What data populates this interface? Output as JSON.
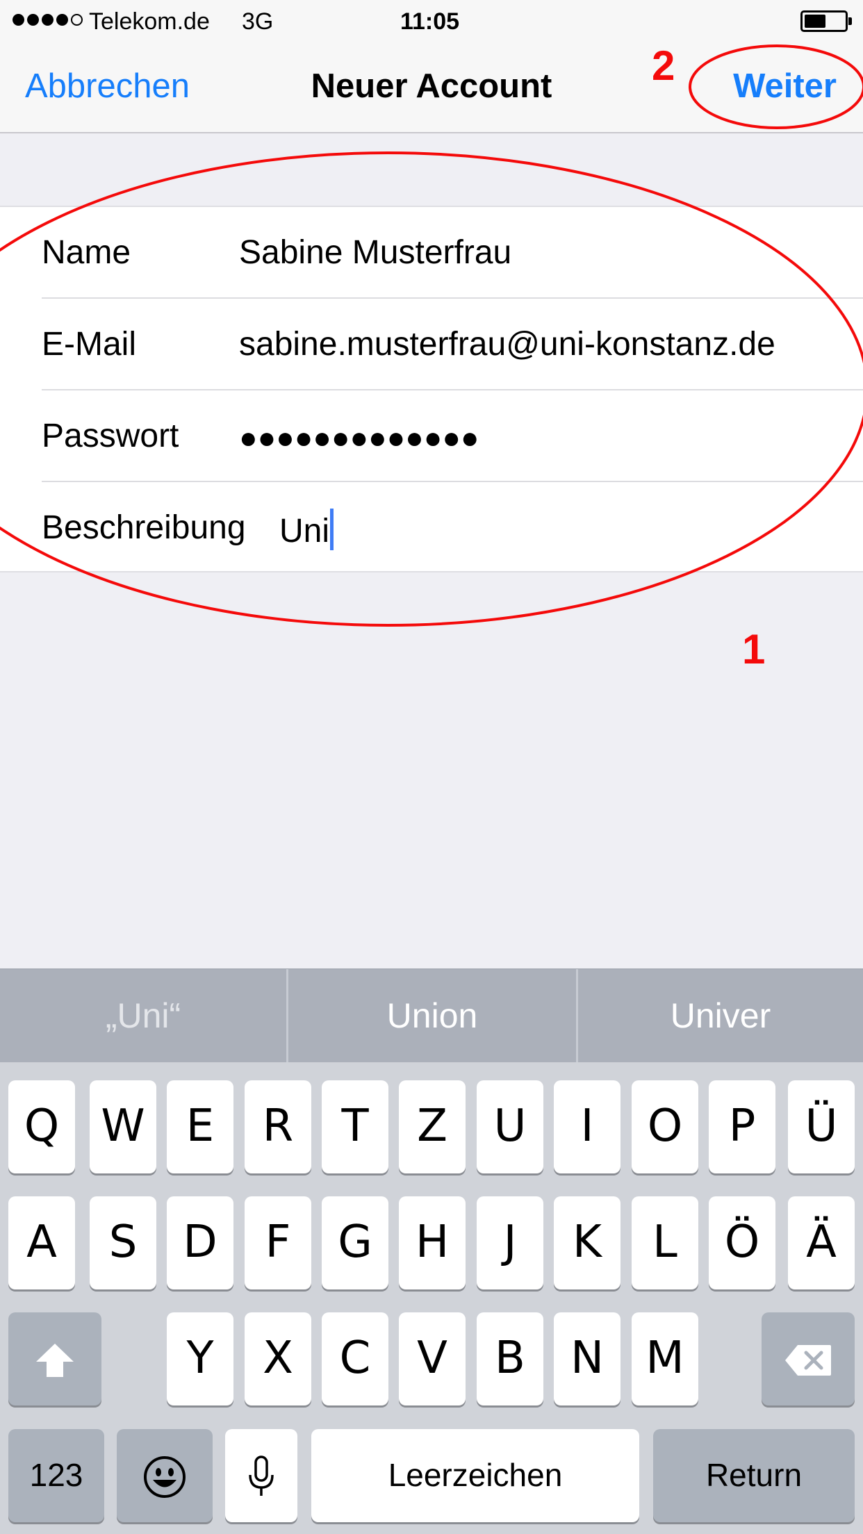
{
  "status_bar": {
    "carrier": "Telekom.de",
    "network": "3G",
    "time": "11:05",
    "signal_strength": 4,
    "signal_max": 5,
    "battery_level": 0.55
  },
  "nav": {
    "cancel": "Abbrechen",
    "title": "Neuer Account",
    "next": "Weiter"
  },
  "form": {
    "fields": [
      {
        "label": "Name",
        "value": "Sabine Musterfrau"
      },
      {
        "label": "E-Mail",
        "value": "sabine.musterfrau@uni-konstanz.de"
      },
      {
        "label": "Passwort",
        "value": "●●●●●●●●●●●●●"
      },
      {
        "label": "Beschreibung",
        "value": "Uni"
      }
    ]
  },
  "annotations": {
    "marker_1": "1",
    "marker_2": "2",
    "color": "#f40a0a"
  },
  "keyboard": {
    "predictions": [
      "„Uni“",
      "Union",
      "Univer"
    ],
    "row1": [
      "Q",
      "W",
      "E",
      "R",
      "T",
      "Z",
      "U",
      "I",
      "O",
      "P",
      "Ü"
    ],
    "row2": [
      "A",
      "S",
      "D",
      "F",
      "G",
      "H",
      "J",
      "K",
      "L",
      "Ö",
      "Ä"
    ],
    "row3": [
      "Y",
      "X",
      "C",
      "V",
      "B",
      "N",
      "M"
    ],
    "numbers": "123",
    "space": "Leerzeichen",
    "return": "Return",
    "icons": [
      "shift-icon",
      "backspace-icon",
      "emoji-icon",
      "microphone-icon"
    ]
  },
  "colors": {
    "accent": "#167efb",
    "cursor": "#3f7cf5"
  }
}
